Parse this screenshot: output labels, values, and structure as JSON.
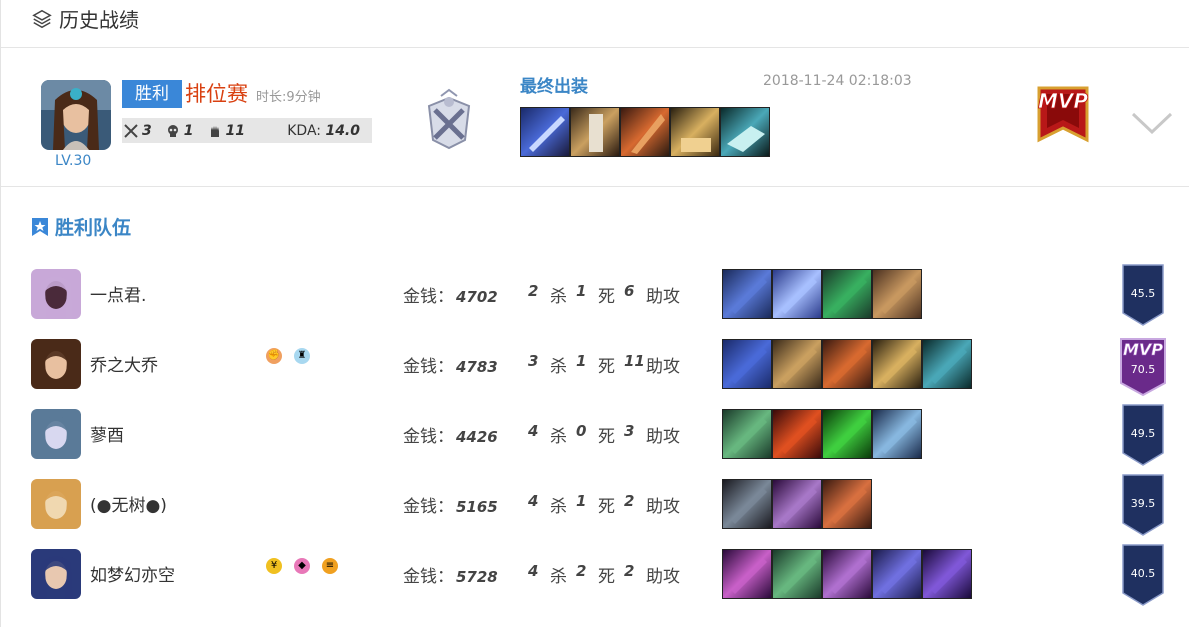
{
  "header": {
    "title": "历史战绩",
    "icon": "layers-icon"
  },
  "match": {
    "result": "胜利",
    "mode": "排位赛",
    "duration": "时长:9分钟",
    "level": "LV.30",
    "kills": "3",
    "deaths": "1",
    "assists": "11",
    "kda_label": "KDA:",
    "kda_value": "14.0",
    "final_items_label": "最终出装",
    "timestamp": "2018-11-24 02:18:03",
    "mvp": "MVP",
    "final_items": [
      "item-blue-blade",
      "item-gold-armor",
      "item-red-axe",
      "item-gold-boots",
      "item-teal-boots"
    ]
  },
  "team": {
    "title": "胜利队伍",
    "gold_label": "金钱：",
    "kill_label": "杀",
    "death_label": "死",
    "assist_label": "助攻",
    "players": [
      {
        "name": "一点君.",
        "gold": "4702",
        "k": "2",
        "d": "1",
        "a": "6",
        "score": "45.5",
        "mvp": "",
        "items": [
          "i1",
          "i2",
          "i3",
          "i4"
        ],
        "icons": []
      },
      {
        "name": "乔之大乔",
        "gold": "4783",
        "k": "3",
        "d": "1",
        "a": "11",
        "score": "70.5",
        "mvp": "MVP",
        "items": [
          "i1",
          "i2",
          "i3",
          "i4",
          "i5"
        ],
        "icons": [
          "fist-icon",
          "tower-icon"
        ]
      },
      {
        "name": "蓼酉",
        "gold": "4426",
        "k": "4",
        "d": "0",
        "a": "3",
        "score": "49.5",
        "mvp": "",
        "items": [
          "i1",
          "i2",
          "i3",
          "i4"
        ],
        "icons": []
      },
      {
        "name": "(●无树●)",
        "gold": "5165",
        "k": "4",
        "d": "1",
        "a": "2",
        "score": "39.5",
        "mvp": "",
        "items": [
          "i1",
          "i2",
          "i3"
        ],
        "icons": []
      },
      {
        "name": "如梦幻亦空",
        "gold": "5728",
        "k": "4",
        "d": "2",
        "a": "2",
        "score": "40.5",
        "mvp": "",
        "items": [
          "i1",
          "i2",
          "i3",
          "i4",
          "i5"
        ],
        "icons": [
          "coin-icon",
          "shield-icon",
          "bars-icon"
        ]
      }
    ]
  },
  "colors": {
    "accent": "#3a87d8",
    "mode": "#d94010",
    "badge": "#1f3060"
  }
}
